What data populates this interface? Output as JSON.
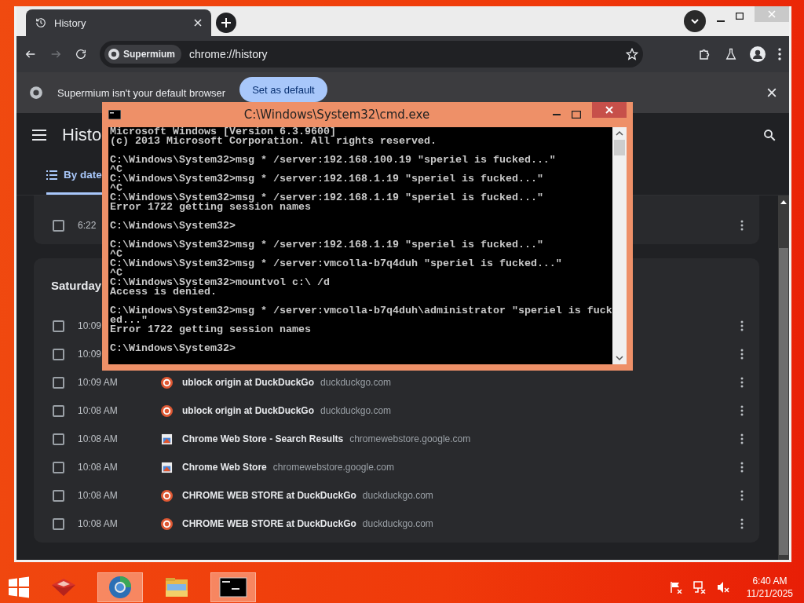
{
  "browser": {
    "tabs": [
      {
        "title": "History",
        "selected": true
      }
    ],
    "toolbar": {
      "site_chip": "Supermium",
      "url": "chrome://history"
    },
    "infobar": {
      "message": "Supermium isn't your default browser",
      "button": "Set as default"
    },
    "page": {
      "title": "Histo",
      "tabs": [
        {
          "label": "By date",
          "selected": true
        }
      ],
      "groups": [
        {
          "rows": [
            {
              "time": "6:22",
              "checked": false
            }
          ]
        },
        {
          "heading": "Saturday",
          "rows": [
            {
              "time": "10:09",
              "checked": false
            },
            {
              "time": "10:09",
              "checked": false
            },
            {
              "time": "10:09 AM",
              "checked": false,
              "kind": "duckduckgo",
              "title": "ublock origin at DuckDuckGo",
              "domain": "duckduckgo.com"
            },
            {
              "time": "10:08 AM",
              "checked": false,
              "kind": "duckduckgo",
              "title": "ublock origin at DuckDuckGo",
              "domain": "duckduckgo.com"
            },
            {
              "time": "10:08 AM",
              "checked": false,
              "kind": "store",
              "title": "Chrome Web Store - Search Results",
              "domain": "chromewebstore.google.com"
            },
            {
              "time": "10:08 AM",
              "checked": false,
              "kind": "store",
              "title": "Chrome Web Store",
              "domain": "chromewebstore.google.com"
            },
            {
              "time": "10:08 AM",
              "checked": false,
              "kind": "duckduckgo",
              "title": "CHROME WEB STORE at DuckDuckGo",
              "domain": "duckduckgo.com"
            },
            {
              "time": "10:08 AM",
              "checked": false,
              "kind": "duckduckgo",
              "title": "CHROME WEB STORE at DuckDuckGo",
              "domain": "duckduckgo.com"
            }
          ]
        }
      ]
    }
  },
  "console": {
    "title": "C:\\Windows\\System32\\cmd.exe",
    "blocks": [
      [
        "Microsoft Windows [Version 6.3.9600]",
        "(c) 2013 Microsoft Corporation. All rights reserved."
      ],
      [
        "C:\\Windows\\System32>msg * /server:192.168.100.19 \"speriel is fucked...\"",
        "^C",
        "C:\\Windows\\System32>msg * /server:192.168.1.19 \"speriel is fucked...\"",
        "^C",
        "C:\\Windows\\System32>msg * /server:192.168.1.19 \"speriel is fucked...\"",
        "Error 1722 getting session names"
      ],
      [
        "C:\\Windows\\System32>"
      ],
      [
        "C:\\Windows\\System32>msg * /server:192.168.1.19 \"speriel is fucked...\"",
        "^C",
        "C:\\Windows\\System32>msg * /server:vmcolla-b7q4duh \"speriel is fucked...\"",
        "^C",
        "C:\\Windows\\System32>mountvol c:\\ /d",
        "Access is denied."
      ],
      [
        "C:\\Windows\\System32>msg * /server:vmcolla-b7q4duh\\administrator \"speriel is fuck",
        "ed...\"",
        "Error 1722 getting session names"
      ],
      [
        "C:\\Windows\\System32>"
      ]
    ]
  },
  "taskbar": {
    "apps": [
      {
        "kind": "box",
        "active": false
      },
      {
        "kind": "browser",
        "active": true
      },
      {
        "kind": "folder",
        "active": false
      },
      {
        "kind": "console",
        "active": true
      }
    ],
    "time": "6:40 AM",
    "date": "11/21/2025"
  }
}
